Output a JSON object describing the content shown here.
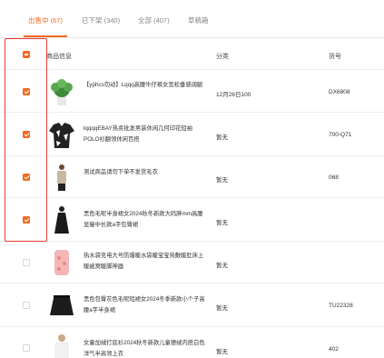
{
  "tabs": [
    {
      "label": "出售中 (67)",
      "active": true
    },
    {
      "label": "已下架 (340)",
      "active": false
    },
    {
      "label": "全部 (407)",
      "active": false
    },
    {
      "label": "草稿箱",
      "active": false
    }
  ],
  "table": {
    "col_product": "商品信息",
    "col_category": "分类",
    "col_sku": "货号"
  },
  "rows": [
    {
      "name": "【yphcs勿动】Lqqq高腰牛仔裤女宽松垂感阔腿",
      "category": "12月26日100",
      "sku": "DX6808",
      "checked": true,
      "thumb_icon": "plant-icon"
    },
    {
      "name": "lqqqqEBAY热卖批发男装休闲几何印花短袖POLO衫翻领休闲百搭",
      "category": "暂无",
      "sku": "700-Q71",
      "checked": true,
      "thumb_icon": "shirt-icon"
    },
    {
      "name": "测试商品请勿下单不发货毛衣",
      "category": "暂无",
      "sku": "068",
      "checked": true,
      "thumb_icon": "sweater-icon"
    },
    {
      "name": "黑色毛呢半身裙女2024秋冬新款大码胖mm高腰显瘦中长款a字包臀裙",
      "category": "暂无",
      "sku": "",
      "checked": true,
      "thumb_icon": "dress-icon"
    },
    {
      "name": "热水袋充电大号防爆暖水袋暖宝宝热敷暖肚床上暖被窝暖脚神器",
      "category": "暂无",
      "sku": "",
      "checked": false,
      "thumb_icon": "hot-water-bottle-icon"
    },
    {
      "name": "黑色包臀灰色毛呢短裙女2024冬季新款小个子高腰a字半身裙",
      "category": "暂无",
      "sku": "TU22328",
      "checked": false,
      "thumb_icon": "skirt-icon"
    },
    {
      "name": "女童加绒打底衫2024秋冬新款儿童德绒内搭白色洋气半高领上衣",
      "category": "暂无",
      "sku": "402",
      "checked": false,
      "thumb_icon": "kids-top-icon"
    }
  ],
  "colors": {
    "accent": "#f26b21",
    "highlight": "#e53935"
  }
}
